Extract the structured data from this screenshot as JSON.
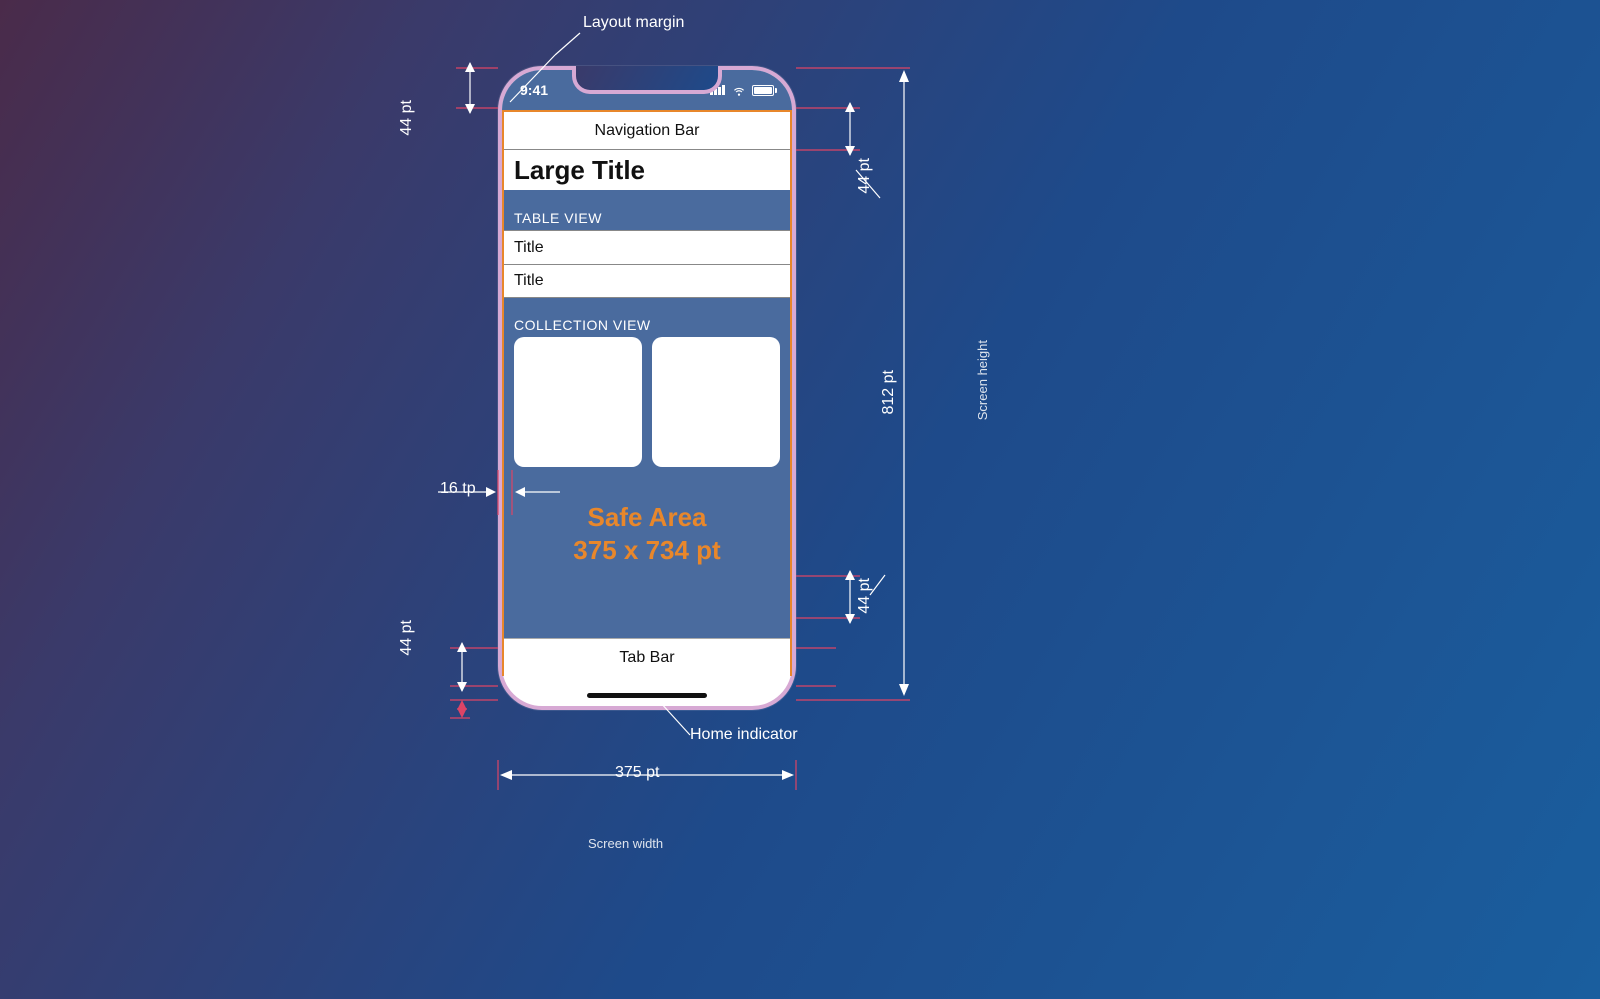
{
  "callouts": {
    "layout_margin": "Layout margin",
    "home_indicator": "Home indicator",
    "screen_width": "Screen width",
    "screen_height": "Screen height"
  },
  "measures": {
    "status_bar_pt": "44 pt",
    "nav_bar_pt": "44 pt",
    "tab_bar_pt": "44 pt",
    "bottom_pt": "44 pt",
    "margin_tp": "16 tp",
    "width_pt": "375 pt",
    "height_pt": "812 pt"
  },
  "phone": {
    "statusbar_time": "9:41",
    "navbar": "Navigation Bar",
    "large_title": "Large Title",
    "table_section": "TABLE VIEW",
    "row1": "Title",
    "row2": "Title",
    "collection_section": "COLLECTION VIEW",
    "safe_area_l1": "Safe Area",
    "safe_area_l2": "375 x 734 pt",
    "tabbar": "Tab Bar"
  }
}
